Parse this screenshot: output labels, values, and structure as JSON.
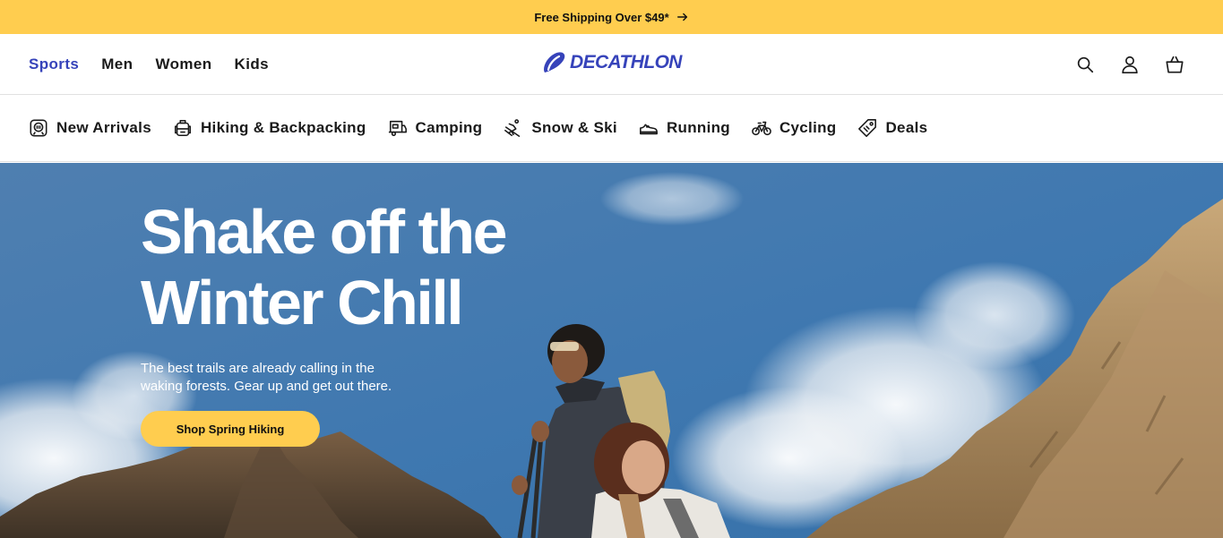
{
  "promo": {
    "text": "Free Shipping Over $49*"
  },
  "header": {
    "gender_nav": [
      "Sports",
      "Men",
      "Women",
      "Kids"
    ],
    "logo_text": "DECATHLON"
  },
  "categories": [
    {
      "label": "New Arrivals",
      "icon": "new-arrivals-icon"
    },
    {
      "label": "Hiking & Backpacking",
      "icon": "backpack-icon"
    },
    {
      "label": "Camping",
      "icon": "camper-icon"
    },
    {
      "label": "Snow & Ski",
      "icon": "skier-icon"
    },
    {
      "label": "Running",
      "icon": "running-shoe-icon"
    },
    {
      "label": "Cycling",
      "icon": "bicycle-icon"
    },
    {
      "label": "Deals",
      "icon": "price-tag-icon"
    }
  ],
  "hero": {
    "title": "Shake off the Winter Chill",
    "subtitle": "The best trails are already calling in the waking forests. Gear up and get out there.",
    "cta": "Shop Spring Hiking"
  },
  "colors": {
    "brand": "#3643ba",
    "accent": "#ffcd4f"
  }
}
